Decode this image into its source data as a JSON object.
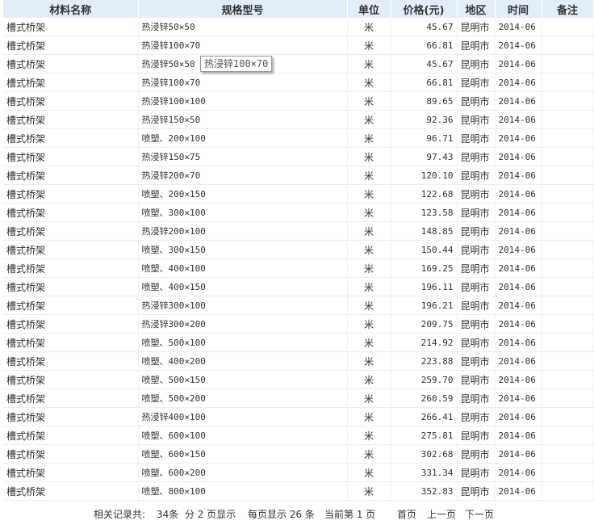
{
  "columns": [
    "材料名称",
    "规格型号",
    "单位",
    "价格(元)",
    "地区",
    "时间",
    "备注"
  ],
  "rows": [
    {
      "name": "槽式桥架",
      "spec": "热浸锌50×50",
      "unit": "米",
      "price": "45.67",
      "region": "昆明市",
      "time": "2014-06",
      "note": ""
    },
    {
      "name": "槽式桥架",
      "spec": "热浸锌100×70",
      "unit": "米",
      "price": "66.81",
      "region": "昆明市",
      "time": "2014-06",
      "note": ""
    },
    {
      "name": "槽式桥架",
      "spec": "热浸锌50×50",
      "unit": "米",
      "price": "45.67",
      "region": "昆明市",
      "time": "2014-06",
      "note": ""
    },
    {
      "name": "槽式桥架",
      "spec": "热浸锌100×70",
      "unit": "米",
      "price": "66.81",
      "region": "昆明市",
      "time": "2014-06",
      "note": ""
    },
    {
      "name": "槽式桥架",
      "spec": "热浸锌100×100",
      "unit": "米",
      "price": "89.65",
      "region": "昆明市",
      "time": "2014-06",
      "note": ""
    },
    {
      "name": "槽式桥架",
      "spec": "热浸锌150×50",
      "unit": "米",
      "price": "92.36",
      "region": "昆明市",
      "time": "2014-06",
      "note": ""
    },
    {
      "name": "槽式桥架",
      "spec": "喷塑、200×100",
      "unit": "米",
      "price": "96.71",
      "region": "昆明市",
      "time": "2014-06",
      "note": ""
    },
    {
      "name": "槽式桥架",
      "spec": "热浸锌150×75",
      "unit": "米",
      "price": "97.43",
      "region": "昆明市",
      "time": "2014-06",
      "note": ""
    },
    {
      "name": "槽式桥架",
      "spec": "热浸锌200×70",
      "unit": "米",
      "price": "120.10",
      "region": "昆明市",
      "time": "2014-06",
      "note": ""
    },
    {
      "name": "槽式桥架",
      "spec": "喷塑、200×150",
      "unit": "米",
      "price": "122.68",
      "region": "昆明市",
      "time": "2014-06",
      "note": ""
    },
    {
      "name": "槽式桥架",
      "spec": "喷塑、300×100",
      "unit": "米",
      "price": "123.58",
      "region": "昆明市",
      "time": "2014-06",
      "note": ""
    },
    {
      "name": "槽式桥架",
      "spec": "热浸锌200×100",
      "unit": "米",
      "price": "148.85",
      "region": "昆明市",
      "time": "2014-06",
      "note": ""
    },
    {
      "name": "槽式桥架",
      "spec": "喷塑、300×150",
      "unit": "米",
      "price": "150.44",
      "region": "昆明市",
      "time": "2014-06",
      "note": ""
    },
    {
      "name": "槽式桥架",
      "spec": "喷塑、400×100",
      "unit": "米",
      "price": "169.25",
      "region": "昆明市",
      "time": "2014-06",
      "note": ""
    },
    {
      "name": "槽式桥架",
      "spec": "喷塑、400×150",
      "unit": "米",
      "price": "196.11",
      "region": "昆明市",
      "time": "2014-06",
      "note": ""
    },
    {
      "name": "槽式桥架",
      "spec": "热浸锌300×100",
      "unit": "米",
      "price": "196.21",
      "region": "昆明市",
      "time": "2014-06",
      "note": ""
    },
    {
      "name": "槽式桥架",
      "spec": "热浸锌300×200",
      "unit": "米",
      "price": "209.75",
      "region": "昆明市",
      "time": "2014-06",
      "note": ""
    },
    {
      "name": "槽式桥架",
      "spec": "喷塑、500×100",
      "unit": "米",
      "price": "214.92",
      "region": "昆明市",
      "time": "2014-06",
      "note": ""
    },
    {
      "name": "槽式桥架",
      "spec": "喷塑、400×200",
      "unit": "米",
      "price": "223.88",
      "region": "昆明市",
      "time": "2014-06",
      "note": ""
    },
    {
      "name": "槽式桥架",
      "spec": "喷塑、500×150",
      "unit": "米",
      "price": "259.70",
      "region": "昆明市",
      "time": "2014-06",
      "note": ""
    },
    {
      "name": "槽式桥架",
      "spec": "喷塑、500×200",
      "unit": "米",
      "price": "260.59",
      "region": "昆明市",
      "time": "2014-06",
      "note": ""
    },
    {
      "name": "槽式桥架",
      "spec": "热浸锌400×100",
      "unit": "米",
      "price": "266.41",
      "region": "昆明市",
      "time": "2014-06",
      "note": ""
    },
    {
      "name": "槽式桥架",
      "spec": "喷塑、600×100",
      "unit": "米",
      "price": "275.81",
      "region": "昆明市",
      "time": "2014-06",
      "note": ""
    },
    {
      "name": "槽式桥架",
      "spec": "喷塑、600×150",
      "unit": "米",
      "price": "302.68",
      "region": "昆明市",
      "time": "2014-06",
      "note": ""
    },
    {
      "name": "槽式桥架",
      "spec": "喷塑、600×200",
      "unit": "米",
      "price": "331.34",
      "region": "昆明市",
      "time": "2014-06",
      "note": ""
    },
    {
      "name": "槽式桥架",
      "spec": "喷塑、800×100",
      "unit": "米",
      "price": "352.83",
      "region": "昆明市",
      "time": "2014-06",
      "note": ""
    }
  ],
  "tooltip": "热浸锌100×70",
  "pager": {
    "total_label": "相关记录共:",
    "total_value": "34条",
    "pages_label": "分 2 页显示",
    "per_page_label": "每页显示 26 条",
    "current_label": "当前第 1 页",
    "first": "首页",
    "prev": "上一页",
    "next": "下一页"
  },
  "colors": {
    "header_bg": "#e3edf8",
    "row_border": "#e8eef5",
    "text": "#333333"
  }
}
